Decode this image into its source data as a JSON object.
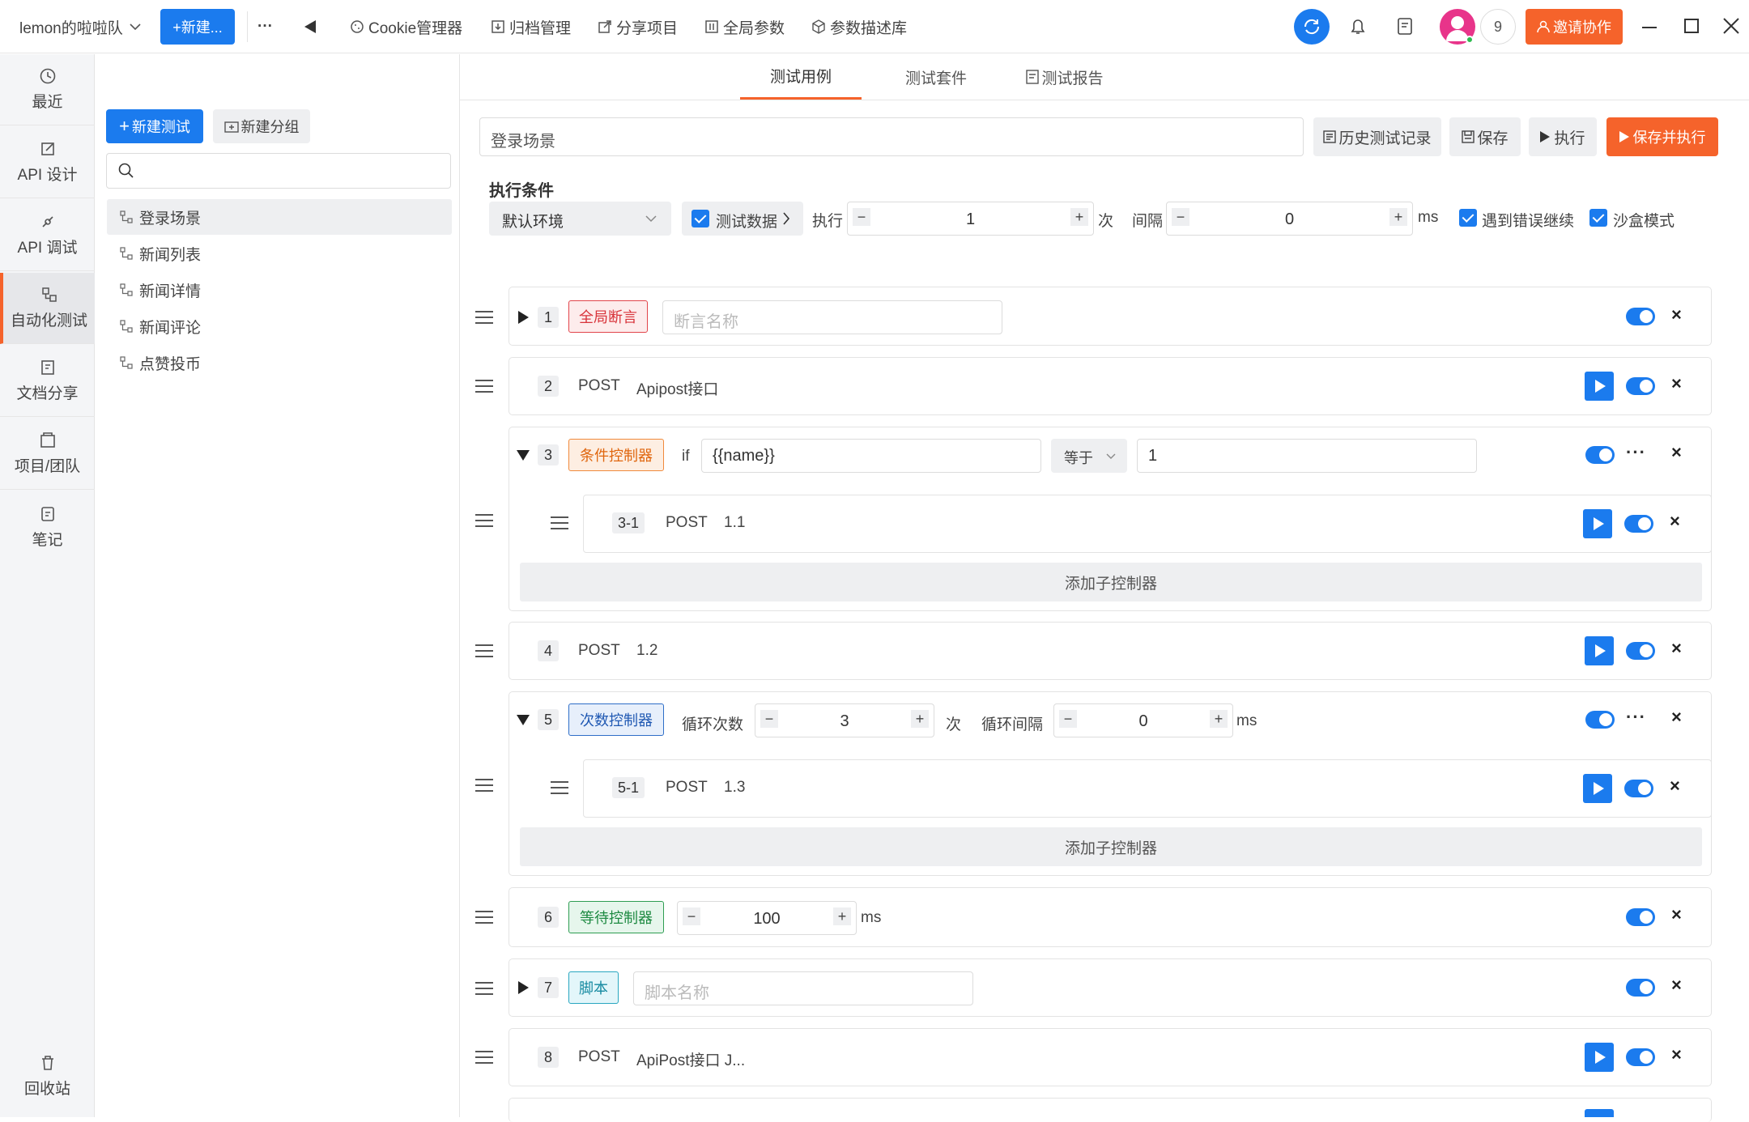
{
  "topbar": {
    "team": "lemon的啦啦队",
    "new_btn": "+新建...",
    "more": "···",
    "cookie": "Cookie管理器",
    "archive": "归档管理",
    "share": "分享项目",
    "global_params": "全局参数",
    "param_lib": "参数描述库",
    "member_count": "9",
    "invite": "邀请协作"
  },
  "nav": {
    "recent": "最近",
    "api_design": "API 设计",
    "api_debug": "API 调试",
    "automation": "自动化测试",
    "doc_share": "文档分享",
    "project": "项目/团队",
    "notes": "笔记",
    "trash": "回收站"
  },
  "tree": {
    "new_test": "新建测试",
    "new_group": "新建分组",
    "search_placeholder": "",
    "items": [
      "登录场景",
      "新闻列表",
      "新闻详情",
      "新闻评论",
      "点赞投币"
    ]
  },
  "tabs": [
    "测试用例",
    "测试套件",
    "测试报告"
  ],
  "editor": {
    "name": "登录场景",
    "history": "历史测试记录",
    "save": "保存",
    "run": "执行",
    "save_run": "保存并执行",
    "cond_title": "执行条件",
    "env": "默认环境",
    "test_data": "测试数据",
    "exec_label": "执行",
    "exec_count": "1",
    "times_unit": "次",
    "interval_label": "间隔",
    "interval_value": "0",
    "ms": "ms",
    "continue_on_error": "遇到错误继续",
    "sandbox": "沙盒模式"
  },
  "steps": {
    "s1": {
      "num": "1",
      "tag": "全局断言",
      "placeholder": "断言名称"
    },
    "s2": {
      "num": "2",
      "method": "POST",
      "name": "Apipost接口"
    },
    "s3": {
      "num": "3",
      "tag": "条件控制器",
      "if": "if",
      "var": "{{name}}",
      "op": "等于",
      "value": "1",
      "child": {
        "num": "3-1",
        "method": "POST",
        "name": "1.1"
      },
      "add_child": "添加子控制器"
    },
    "s4": {
      "num": "4",
      "method": "POST",
      "name": "1.2"
    },
    "s5": {
      "num": "5",
      "tag": "次数控制器",
      "loop_label": "循环次数",
      "loop_count": "3",
      "times": "次",
      "interval_label": "循环间隔",
      "interval": "0",
      "ms": "ms",
      "child": {
        "num": "5-1",
        "method": "POST",
        "name": "1.3"
      },
      "add_child": "添加子控制器"
    },
    "s6": {
      "num": "6",
      "tag": "等待控制器",
      "value": "100",
      "ms": "ms"
    },
    "s7": {
      "num": "7",
      "tag": "脚本",
      "placeholder": "脚本名称"
    },
    "s8": {
      "num": "8",
      "method": "POST",
      "name": "ApiPost接口 J..."
    }
  },
  "colors": {
    "primary": "#1b7bee",
    "accent": "#f5632b"
  }
}
